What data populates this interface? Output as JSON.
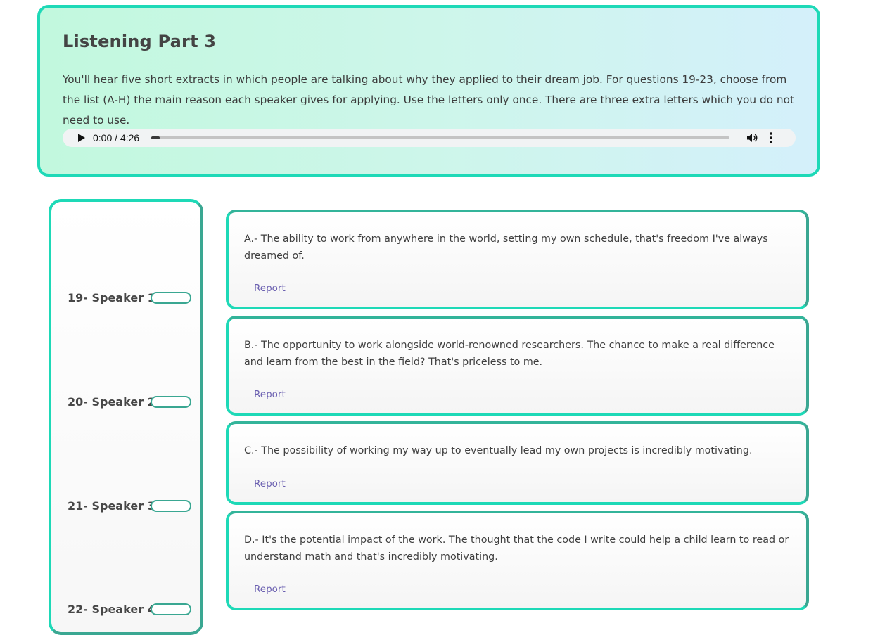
{
  "header": {
    "title": "Listening Part 3",
    "instructions": "You'll hear five short extracts in which people are talking about why they applied to their dream job. For questions 19-23, choose from the list (A-H) the main reason each speaker gives for applying. Use the letters only once. There are three extra letters which you do not need to use."
  },
  "audio": {
    "time": "0:00 / 4:26",
    "progress": 0.0,
    "icons": [
      "play-icon",
      "volume-icon",
      "more-vertical-icon"
    ]
  },
  "speakers": [
    {
      "label": "19- Speaker 1",
      "value": ""
    },
    {
      "label": "20- Speaker 2",
      "value": ""
    },
    {
      "label": "21- Speaker 3",
      "value": ""
    },
    {
      "label": "22- Speaker 4",
      "value": ""
    }
  ],
  "options": [
    {
      "text": "A.- The ability to work from anywhere in the world, setting my own schedule, that's freedom I've always dreamed of.",
      "report": "Report"
    },
    {
      "text": "B.- The opportunity to work alongside world-renowned researchers. The chance to make a real difference and learn from the best in the field? That's priceless to me.",
      "report": "Report"
    },
    {
      "text": "C.- The possibility of working my way up to eventually lead my own projects is incredibly motivating.",
      "report": "Report"
    },
    {
      "text": "D.- It's the potential impact of the work. The thought that the code I write could help a child learn to read or understand math and that's incredibly motivating.",
      "report": "Report"
    }
  ],
  "colors": {
    "accent": "#1ed9b7",
    "accent_dark": "#3aa792",
    "report_link": "#6a5fb0"
  }
}
